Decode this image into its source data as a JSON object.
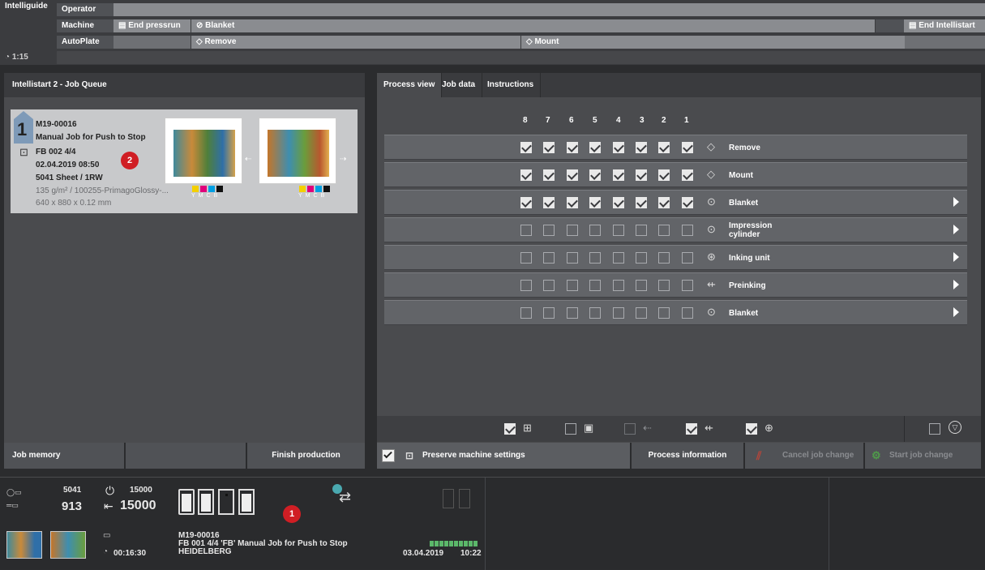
{
  "topbar": {
    "app_name": "Intelliguide",
    "timer": "1:15",
    "rows": [
      {
        "label": "Operator"
      },
      {
        "label": "Machine",
        "end_pressrun": "End pressrun",
        "blanket": "Blanket",
        "end_intellistart": "End Intellistart"
      },
      {
        "label": "AutoPlate",
        "remove": "Remove",
        "mount": "Mount"
      }
    ]
  },
  "queue": {
    "title": "Intellistart 2 - Job Queue",
    "job": {
      "index": "1",
      "number": "M19-00016",
      "name": "Manual Job for Push to Stop",
      "form": "FB 002  4/4",
      "date": "02.04.2019 08:50",
      "sheet": "5041 Sheet / 1RW",
      "paper": "135 g/m² / 100255-PrimagoGlossy-...",
      "size": "640 x 880 x 0.12 mm",
      "colors": [
        "Y",
        "M",
        "C",
        "B"
      ]
    },
    "badge": "2"
  },
  "process": {
    "tabs": [
      "Process view",
      "Job data",
      "Instructions"
    ],
    "units": [
      "8",
      "7",
      "6",
      "5",
      "4",
      "3",
      "2",
      "1"
    ],
    "rows": [
      {
        "label": "Remove",
        "checked": true,
        "arrow": false
      },
      {
        "label": "Mount",
        "checked": true,
        "arrow": false
      },
      {
        "label": "Blanket",
        "checked": true,
        "arrow": true
      },
      {
        "label": "Impression cylinder",
        "checked": false,
        "arrow": true
      },
      {
        "label": "Inking unit",
        "checked": false,
        "arrow": true
      },
      {
        "label": "Preinking",
        "checked": false,
        "arrow": true
      },
      {
        "label": "Blanket",
        "checked": false,
        "arrow": true
      }
    ]
  },
  "buttons": {
    "job_memory": "Job memory",
    "finish_production": "Finish production",
    "preserve": "Preserve machine settings",
    "process_info": "Process information",
    "cancel_change": "Cancel job change",
    "start_change": "Start job change"
  },
  "status": {
    "sheets_total": "5041",
    "sheets_done": "913",
    "speed_set": "15000",
    "speed_actual": "15000",
    "time": "00:16:30",
    "job_number": "M19-00016",
    "job_line": "FB 001  4/4 'FB' Manual Job for Push to Stop",
    "company": "HEIDELBERG",
    "date": "03.04.2019",
    "clock": "10:22",
    "badge": "1"
  }
}
